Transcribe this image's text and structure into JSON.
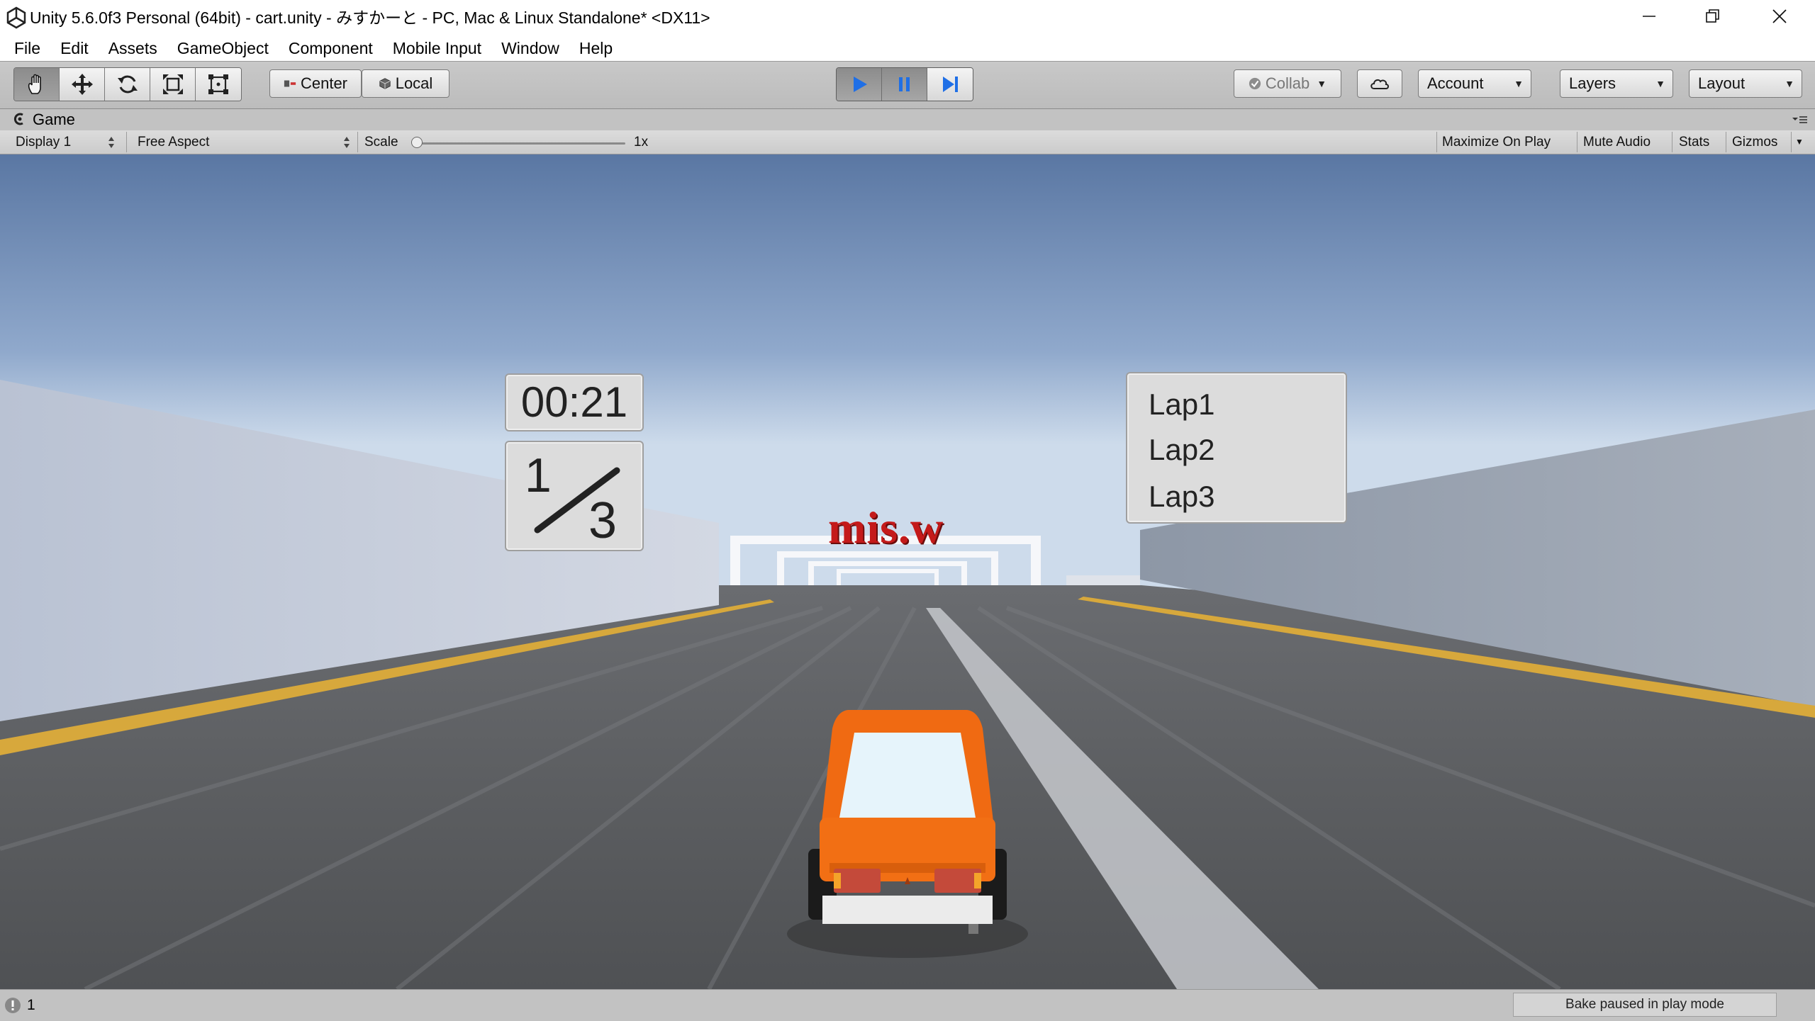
{
  "window": {
    "title": "Unity 5.6.0f3 Personal (64bit) - cart.unity - みすかーと - PC, Mac & Linux Standalone* <DX11>",
    "controls": [
      "minimize-icon",
      "restore-icon",
      "close-icon"
    ]
  },
  "menu": [
    "File",
    "Edit",
    "Assets",
    "GameObject",
    "Component",
    "Mobile Input",
    "Window",
    "Help"
  ],
  "toolbar": {
    "tools": [
      "hand-tool-icon",
      "move-tool-icon",
      "rotate-tool-icon",
      "scale-tool-icon",
      "rect-tool-icon"
    ],
    "pivot_mode": "Center",
    "pivot_rotation": "Local",
    "playback": {
      "play_active": true,
      "pause_active": true
    },
    "collab": "Collab",
    "account": "Account",
    "layers": "Layers",
    "layout": "Layout",
    "accent_color": "#1f6fe6"
  },
  "game_tab": {
    "label": "Game"
  },
  "game_bar": {
    "display": "Display 1",
    "aspect": "Free Aspect",
    "scale_label": "Scale",
    "scale_value": "1x",
    "maximize_on_play": "Maximize On Play",
    "mute_audio": "Mute Audio",
    "stats": "Stats",
    "gizmos": "Gizmos"
  },
  "hud": {
    "timer": "00:21",
    "lap_current": "1",
    "lap_total": "3",
    "laps": [
      "Lap1",
      "Lap2",
      "Lap3"
    ],
    "sign_text": "mis.w",
    "car_color": "#f06a12",
    "sign_color": "#c41a1a"
  },
  "status": {
    "warning_count": "1",
    "bake_status": "Bake paused in play mode"
  }
}
